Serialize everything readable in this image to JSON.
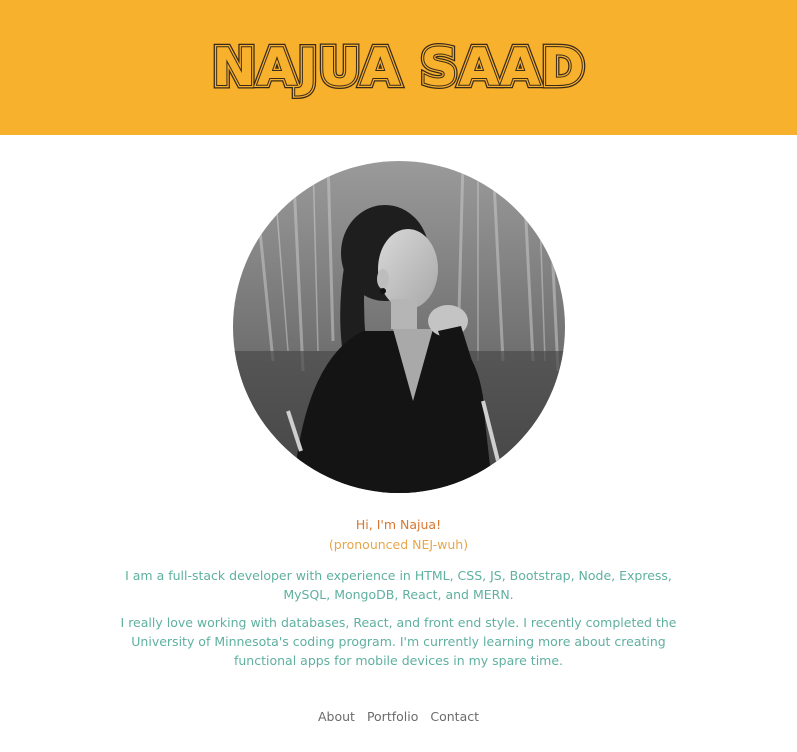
{
  "header": {
    "logo_text": "NAJUA SAAD",
    "background_color": "#f7b12d",
    "logo_color": "#3a2a1a"
  },
  "profile": {
    "photo_icon": "profile-photo",
    "greeting": "Hi, I'm Najua!",
    "pronunciation": "(pronounced NEJ-wuh)",
    "bio_paragraph_1": "I am a full-stack developer with experience in HTML, CSS, JS, Bootstrap, Node, Express, MySQL, MongoDB, React, and MERN.",
    "bio_paragraph_2": "I really love working with databases, React, and front end style. I recently completed the University of Minnesota's coding program. I'm currently learning more about creating functional apps for mobile devices in my spare time."
  },
  "colors": {
    "greeting": "#d8772f",
    "pronunciation": "#e8a54a",
    "bio": "#5fb0a0",
    "nav": "#6b6b6b"
  },
  "nav": {
    "items": [
      {
        "label": "About"
      },
      {
        "label": "Portfolio"
      },
      {
        "label": "Contact"
      }
    ]
  }
}
